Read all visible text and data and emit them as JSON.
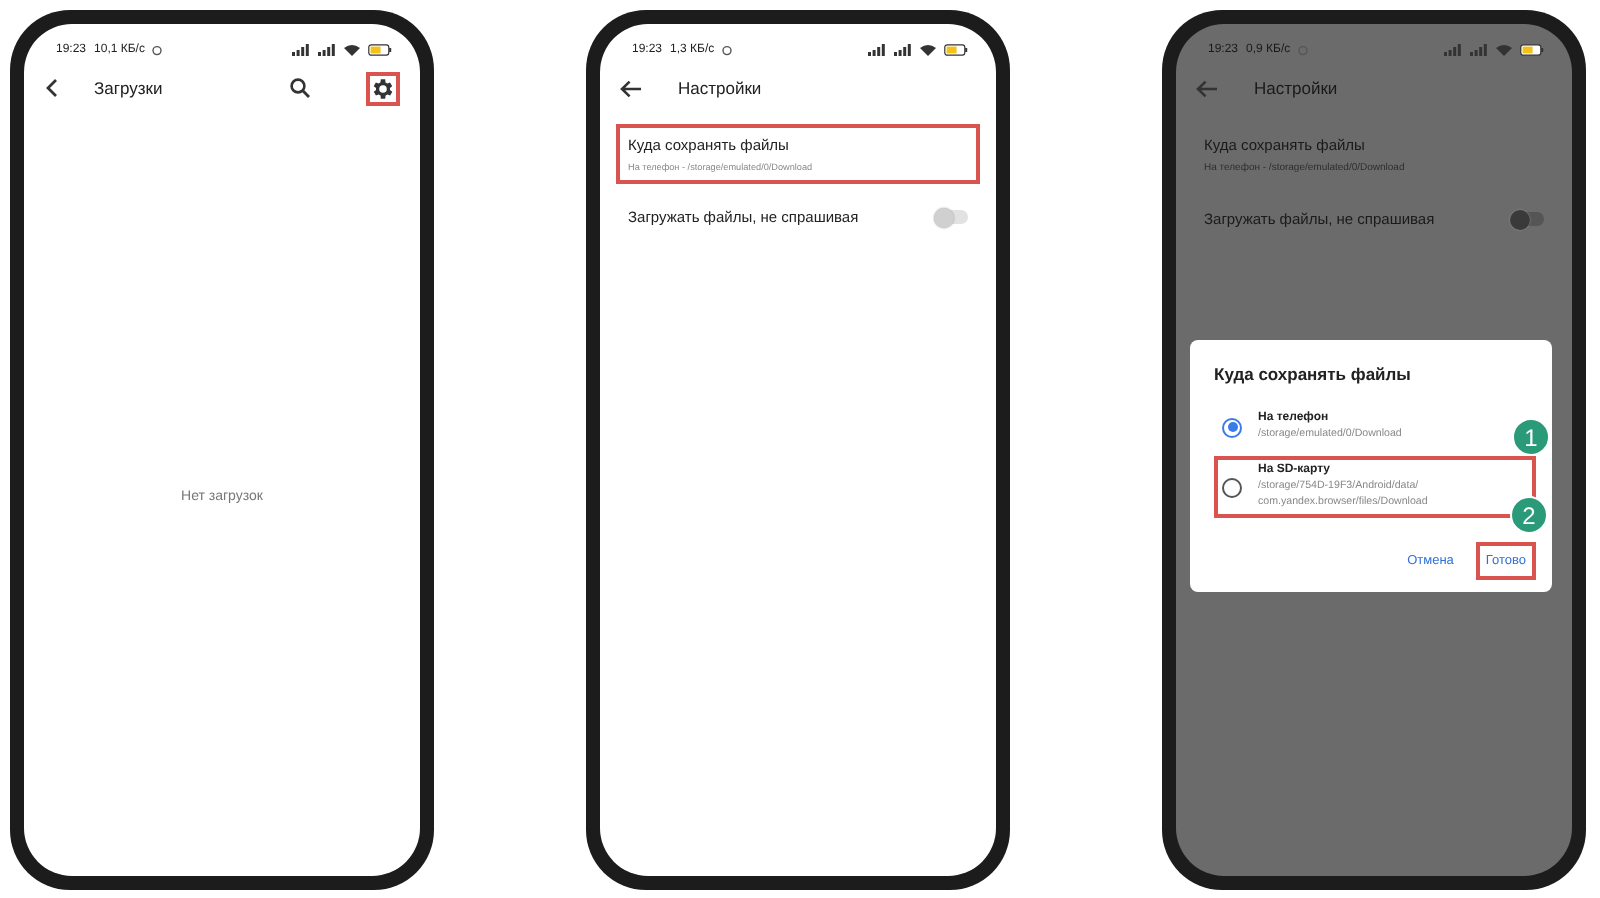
{
  "downloads_screen": {
    "status_bar": {
      "time": "19:23",
      "speed": "10,1 КБ/с"
    },
    "title": "Загрузки",
    "settings_highlighted": true,
    "empty_message": "Нет загрузок"
  },
  "settings_screen": {
    "status_bar": {
      "time": "19:23",
      "speed": "1,3 КБ/с"
    },
    "title": "Настройки",
    "items": [
      {
        "kind": "link",
        "title": "Куда сохранять файлы",
        "subtitle": "На телефон - /storage/emulated/0/Download",
        "highlighted": true
      },
      {
        "kind": "toggle",
        "title": "Загружать файлы, не спрашивая",
        "on": false,
        "highlighted": false
      }
    ]
  },
  "dialog_screen": {
    "status_bar": {
      "time": "19:23",
      "speed": "0,9 КБ/с"
    },
    "title": "Настройки",
    "items": [
      {
        "kind": "link",
        "title": "Куда сохранять файлы",
        "subtitle": "На телефон - /storage/emulated/0/Download",
        "highlighted": false
      },
      {
        "kind": "toggle",
        "title": "Загружать файлы, не спрашивая",
        "on": false,
        "highlighted": false
      }
    ],
    "dialog": {
      "title": "Куда сохранять файлы",
      "options": [
        {
          "label": "На телефон",
          "path": "/storage/emulated/0/Download",
          "selected": true,
          "highlighted": false
        },
        {
          "label": "На SD-карту",
          "path": "/storage/754D-19F3/Android/data/com.yandex.browser/files/Download",
          "selected": false,
          "highlighted": true,
          "badge": "1"
        }
      ],
      "buttons": [
        {
          "label": "Отмена",
          "highlighted": false
        },
        {
          "label": "Готово",
          "highlighted": true,
          "badge": "2"
        }
      ]
    }
  }
}
